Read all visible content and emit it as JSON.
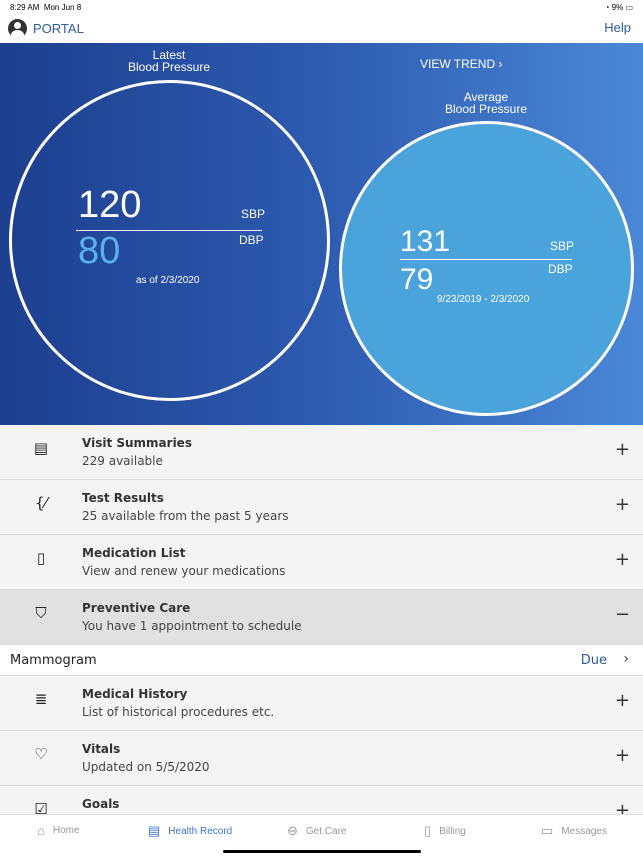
{
  "status": {
    "time": "8:29 AM",
    "date": "Mon Jun 8",
    "battery": "9%"
  },
  "nav": {
    "title": "PORTAL",
    "help": "Help"
  },
  "latest": {
    "label1": "Latest",
    "label2": "Blood Pressure",
    "sbp": "120",
    "dbp": "80",
    "sbp_label": "SBP",
    "dbp_label": "DBP",
    "as_of": "as of 2/3/2020"
  },
  "trend": {
    "label": "VIEW TREND"
  },
  "average": {
    "label1": "Average",
    "label2": "Blood Pressure",
    "sbp": "131",
    "dbp": "79",
    "sbp_label": "SBP",
    "dbp_label": "DBP",
    "range": "9/23/2019 - 2/3/2020"
  },
  "colors": {
    "accent": "#2f5a9e",
    "average_fill": "#4aa3db",
    "gradient_start": "#1d3f8f",
    "gradient_end": "#4b88d8"
  },
  "rows": [
    {
      "title": "Visit Summaries",
      "sub": "229 available",
      "icon": "document-icon",
      "toggle": "+"
    },
    {
      "title": "Test Results",
      "sub": "25 available from the past 5 years",
      "icon": "test-tube-icon",
      "toggle": "+"
    },
    {
      "title": "Medication List",
      "sub": "View and renew your medications",
      "icon": "pill-bottle-icon",
      "toggle": "+"
    },
    {
      "title": "Preventive Care",
      "sub": "You have 1 appointment to schedule",
      "icon": "shield-heart-icon",
      "toggle": "−"
    },
    {
      "title": "Medical History",
      "sub": "List of historical procedures etc.",
      "icon": "history-icon",
      "toggle": "+"
    },
    {
      "title": "Vitals",
      "sub": "Updated on 5/5/2020",
      "icon": "heartbeat-icon",
      "toggle": "+"
    },
    {
      "title": "Goals",
      "sub": "",
      "icon": "checkbox-icon",
      "toggle": "+"
    }
  ],
  "mammogram": {
    "title": "Mammogram",
    "status": "Due"
  },
  "tabs": [
    {
      "label": "Home"
    },
    {
      "label": "Health Record"
    },
    {
      "label": "Get Care"
    },
    {
      "label": "Billing"
    },
    {
      "label": "Messages"
    }
  ]
}
